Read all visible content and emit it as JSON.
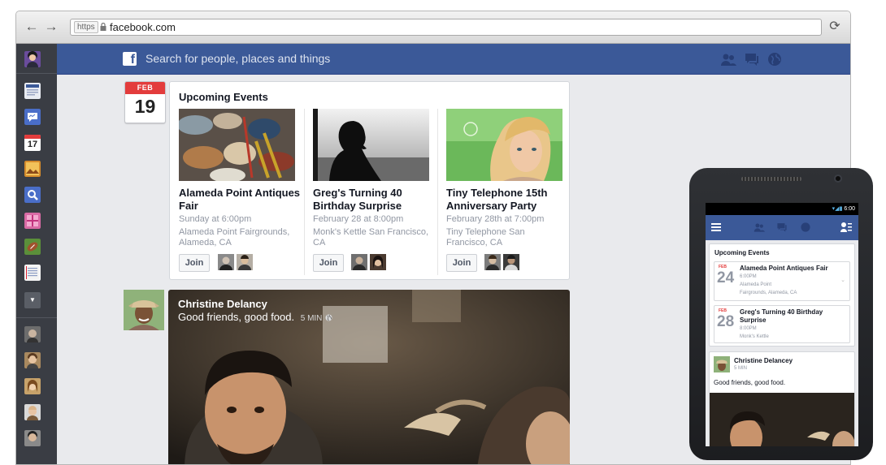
{
  "browser": {
    "url_scheme": "https",
    "url": "facebook.com",
    "back_icon": "arrow-left-icon",
    "forward_icon": "arrow-right-icon",
    "reload_icon": "reload-icon"
  },
  "sidebar": {
    "items": [
      {
        "icon": "user-avatar-icon"
      },
      {
        "icon": "news-feed-icon"
      },
      {
        "icon": "messages-icon"
      },
      {
        "icon": "events-calendar-icon",
        "label": "17"
      },
      {
        "icon": "photos-icon"
      },
      {
        "icon": "search-icon"
      },
      {
        "icon": "gifts-icon"
      },
      {
        "icon": "sports-football-icon"
      },
      {
        "icon": "notes-icon"
      },
      {
        "icon": "more-chevron-icon"
      }
    ],
    "friends": [
      "friend-avatar-1",
      "friend-avatar-2",
      "friend-avatar-3",
      "friend-avatar-4",
      "friend-avatar-5"
    ]
  },
  "bluebar": {
    "search_placeholder": "Search for people, places and things",
    "brand_color": "#3b5998"
  },
  "calendar": {
    "month": "FEB",
    "day": "19"
  },
  "events": {
    "title": "Upcoming Events",
    "items": [
      {
        "name": "Alameda Point Antiques Fair",
        "time": "Sunday at 6:00pm",
        "place": "Alameda Point Fairgrounds, Alameda, CA",
        "join": "Join"
      },
      {
        "name": "Greg's Turning 40 Birthday Surprise",
        "time": "February 28 at 8:00pm",
        "place": "Monk's Kettle San Francisco, CA",
        "join": "Join"
      },
      {
        "name": "Tiny Telephone 15th Anniversary Party",
        "time": "February 28th at 7:00pm",
        "place": "Tiny Telephone San Francisco, CA",
        "join": "Join"
      }
    ]
  },
  "post": {
    "author": "Christine Delancy",
    "text": "Good friends, good food.",
    "time": "5 MIN"
  },
  "mobile": {
    "status_time": "6:00",
    "events_title": "Upcoming Events",
    "events": [
      {
        "month": "FEB",
        "day": "24",
        "name": "Alameda Point Antiques Fair",
        "time": "6:00PM",
        "place1": "Alameda Point",
        "place2": "Fairgrounds, Alameda, CA"
      },
      {
        "month": "FEB",
        "day": "28",
        "name": "Greg's Turning 40 Birthday Surprise",
        "time": "8:00PM",
        "place1": "Monk's Kettle",
        "place2": ""
      }
    ],
    "post_author": "Christine Delancey",
    "post_time": "5 MIN",
    "post_text": "Good friends, good food."
  }
}
